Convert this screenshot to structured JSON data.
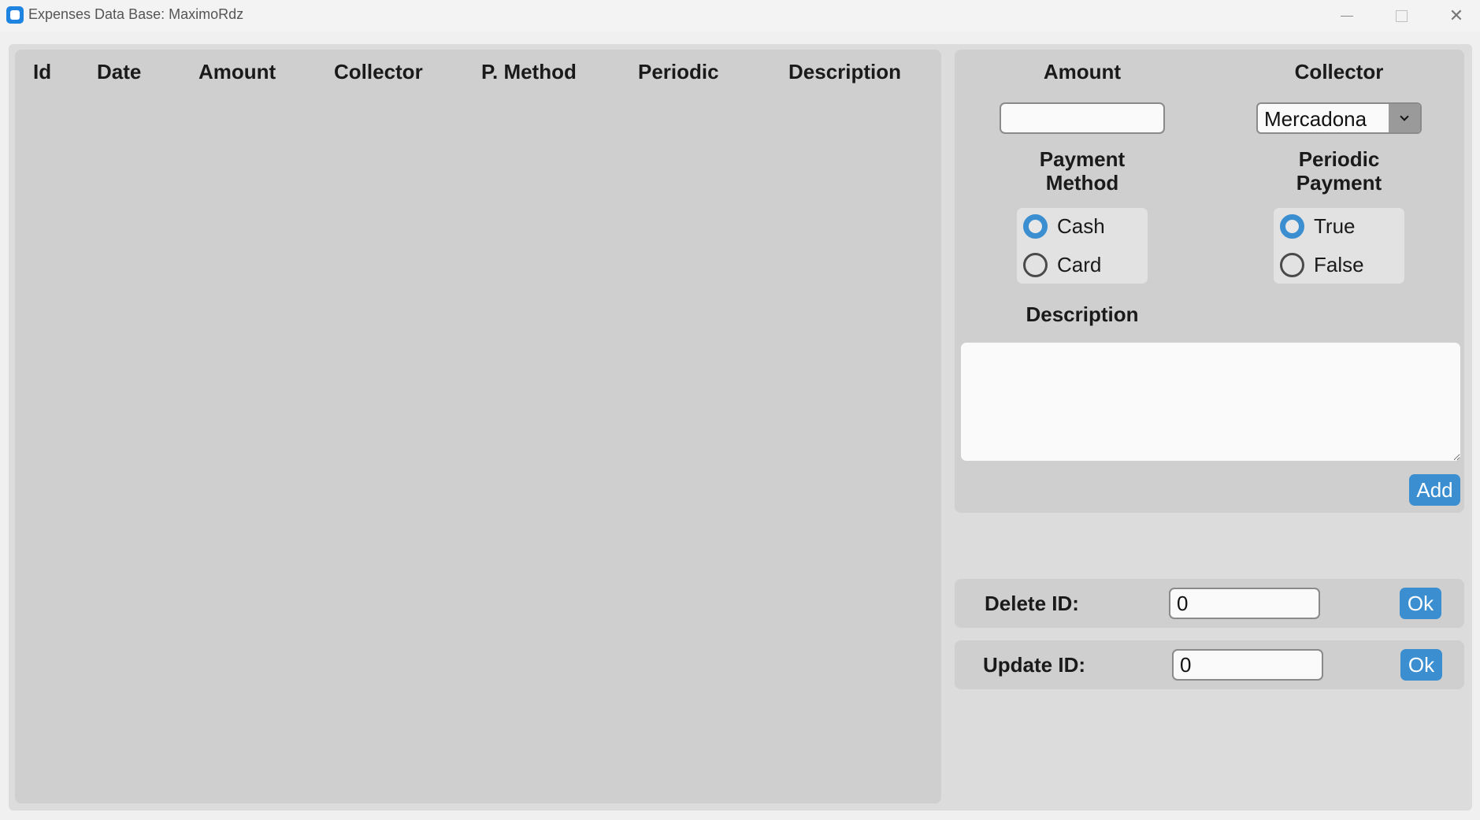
{
  "window": {
    "title": "Expenses Data Base: MaximoRdz",
    "minimize_glyph": "",
    "close_glyph": "✕",
    "accent": "#3b8ed0"
  },
  "table": {
    "columns": [
      "Id",
      "Date",
      "Amount",
      "Collector",
      "P. Method",
      "Periodic",
      "Description"
    ],
    "rows": []
  },
  "form": {
    "amount_label": "Amount",
    "amount_value": "",
    "collector_label": "Collector",
    "collector_selected": "Mercadona",
    "payment_method_label_line1": "Payment",
    "payment_method_label_line2": "Method",
    "payment_options": [
      {
        "label": "Cash",
        "checked": true
      },
      {
        "label": "Card",
        "checked": false
      }
    ],
    "periodic_label_line1": "Periodic",
    "periodic_label_line2": "Payment",
    "periodic_options": [
      {
        "label": "True",
        "checked": true
      },
      {
        "label": "False",
        "checked": false
      }
    ],
    "description_label": "Description",
    "description_value": "",
    "add_label": "Add"
  },
  "delete": {
    "label": "Delete ID:",
    "value": "0",
    "ok_label": "Ok"
  },
  "update": {
    "label": "Update ID:",
    "value": "0",
    "ok_label": "Ok"
  }
}
